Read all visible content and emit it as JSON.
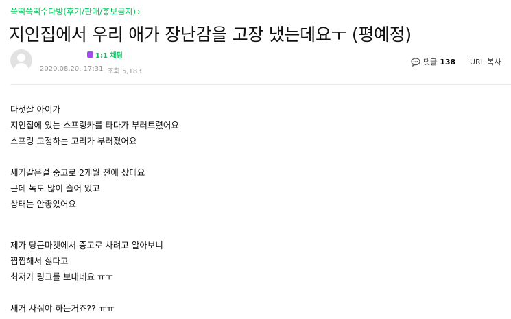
{
  "cafe": {
    "board_name": "쑥떡쑥떡수다방(후기/판매/홍보금지)",
    "chevron": "›"
  },
  "post": {
    "title": "지인집에서 우리 애가 장난감을 고장 냈는데요ㅜ (평예정)",
    "date": "2020.08.20. 17:31",
    "views_label": "조회 5,183"
  },
  "author": {
    "chat_badge": "1:1 채팅",
    "chat_icon_glyph": "■"
  },
  "actions": {
    "comment_label": "댓글",
    "comment_count": "138",
    "url_copy_label": "URL 복사"
  },
  "body": {
    "lines": [
      "다섯살 아이가",
      "지인집에 있는 스프링카를 타다가 부러트렸어요",
      "스프링 고정하는 고리가 부러졌어요",
      "새거같은걸 중고로 2개월 전에 샀데요",
      "근데 녹도 많이 슬어 있고",
      "상태는 안좋았어요",
      "제가 당근마켓에서 중고로 사려고 알아보니",
      "찝찝해서 싫다고",
      "최저가 링크를 보내네요 ㅠㅜ",
      "새거 사줘야 하는거죠?? ㅠㅠ"
    ]
  },
  "colors": {
    "accent": "#03c75a",
    "meta": "#979797",
    "divider": "#ebebeb"
  }
}
